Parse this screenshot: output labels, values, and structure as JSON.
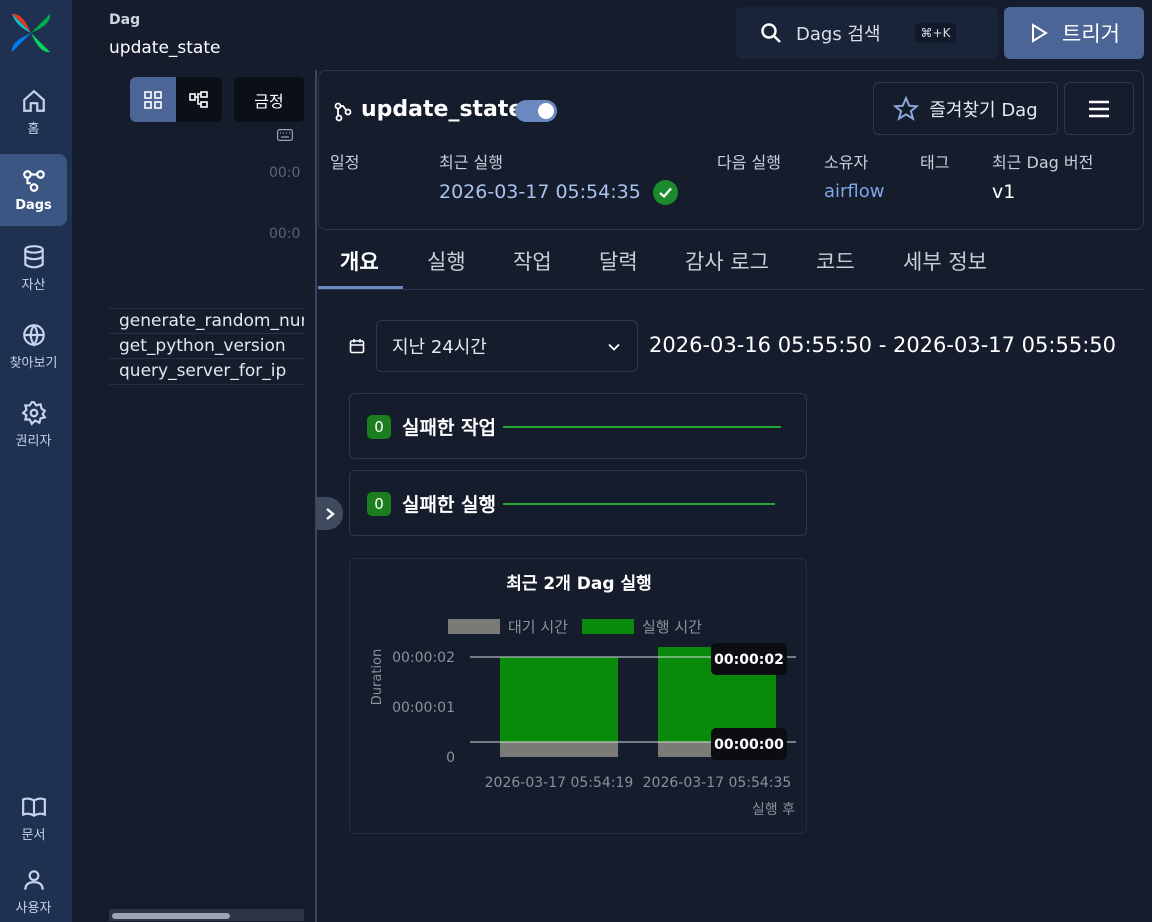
{
  "nav": {
    "items": [
      {
        "label": "홈",
        "icon": "home-icon"
      },
      {
        "label": "Dags",
        "icon": "dags-icon",
        "active": true
      },
      {
        "label": "자산",
        "icon": "database-icon"
      },
      {
        "label": "찾아보기",
        "icon": "globe-icon"
      },
      {
        "label": "권리자",
        "icon": "gear-icon"
      },
      {
        "label": "문서",
        "icon": "book-icon"
      },
      {
        "label": "사용자",
        "icon": "user-icon"
      }
    ]
  },
  "breadcrumb": {
    "section": "Dag",
    "name": "update_state"
  },
  "left": {
    "today_label": "금정",
    "time_ticks": [
      "00:0",
      "00:0"
    ],
    "tasks": [
      "generate_random_num",
      "get_python_version",
      "query_server_for_ip"
    ]
  },
  "topbar": {
    "search_label": "Dags 검색",
    "search_shortcut": "⌘+K",
    "trigger_label": "트리거"
  },
  "dag": {
    "title": "update_state",
    "paused": false,
    "favorite_label": "즐겨찾기 Dag",
    "meta_labels": {
      "schedule": "일정",
      "last_run": "최근 실행",
      "next_run": "다음 실행",
      "owner": "소유자",
      "tags": "태그",
      "dag_version": "최근 Dag 버전"
    },
    "last_run_value": "2026-03-17 05:54:35",
    "last_run_state": "success",
    "owner_value": "airflow",
    "dag_version_value": "v1"
  },
  "tabs": [
    "개요",
    "실행",
    "작업",
    "달력",
    "감사 로그",
    "코드",
    "세부 정보"
  ],
  "range": {
    "selected": "지난 24시간",
    "text": "2026-03-16 05:55:50 - 2026-03-17 05:55:50"
  },
  "stats": [
    {
      "count": "0",
      "label": "실패한 작업"
    },
    {
      "count": "0",
      "label": "실패한 실행"
    }
  ],
  "colors": {
    "success": "#1a8a2c",
    "accent": "#4a6596",
    "queued": "#7a7a76",
    "running": "#0a8a0a"
  },
  "chart_data": {
    "type": "bar",
    "title": "최근 2개 Dag 실행",
    "xlabel": "실행 후",
    "ylabel": "Duration",
    "categories": [
      "2026-03-17 05:54:19",
      "2026-03-17 05:54:35"
    ],
    "series": [
      {
        "name": "대기 시간",
        "color": "#7a7a76",
        "values": [
          0.3,
          0.3
        ]
      },
      {
        "name": "실행 시간",
        "color": "#0a8a0a",
        "values": [
          1.7,
          1.9
        ]
      }
    ],
    "ylim": [
      0,
      2.2
    ],
    "yticks": [
      {
        "value": 0,
        "label": "0"
      },
      {
        "value": 1,
        "label": "00:00:01"
      },
      {
        "value": 2,
        "label": "00:00:02"
      }
    ],
    "reference_lines": [
      {
        "value": 2,
        "label": "00:00:02"
      },
      {
        "value": 0.3,
        "label": "00:00:00"
      }
    ]
  }
}
